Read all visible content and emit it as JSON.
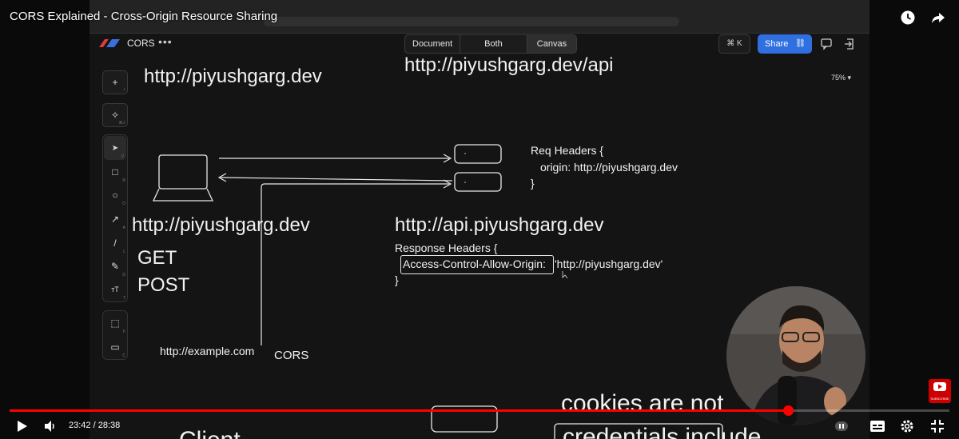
{
  "youtube": {
    "video_title": "CORS Explained - Cross-Origin Resource Sharing",
    "time_current": "23:42",
    "time_separator": " / ",
    "time_total": "28:38",
    "progress_fraction": 0.828,
    "subscribe_label": "SUBSCRIBE",
    "icons": [
      "watch-later-icon",
      "share-icon",
      "play-icon",
      "volume-icon",
      "pause-icon",
      "subtitles-icon",
      "settings-icon",
      "fullscreen-exit-icon"
    ]
  },
  "app": {
    "name": "CORS",
    "menu_label": "•••",
    "view_modes": [
      "Document",
      "Both",
      "Canvas"
    ],
    "active_view": "Canvas",
    "command_shortcut": "⌘ K",
    "share_label": "Share",
    "zoom": "75%"
  },
  "toolbar": {
    "tools": [
      {
        "name": "add",
        "glyph": "+",
        "key": "/"
      },
      {
        "name": "magic",
        "glyph": "✧",
        "key": "⌘J"
      },
      {
        "name": "select",
        "glyph": "➤",
        "key": "V"
      },
      {
        "name": "rectangle",
        "glyph": "□",
        "key": "R"
      },
      {
        "name": "ellipse",
        "glyph": "○",
        "key": "O"
      },
      {
        "name": "arrow",
        "glyph": "↗",
        "key": "A"
      },
      {
        "name": "line",
        "glyph": "/",
        "key": "L"
      },
      {
        "name": "pencil",
        "glyph": "✎",
        "key": "D"
      },
      {
        "name": "text",
        "glyph": "ᴛT",
        "key": "T"
      },
      {
        "name": "frame",
        "glyph": "⬚",
        "key": "F"
      },
      {
        "name": "comment",
        "glyph": "▭",
        "key": "C"
      }
    ]
  },
  "canvas": {
    "origin_top": "http://piyushgarg.dev",
    "api_top": "http://piyushgarg.dev/api",
    "client_origin": "http://piyushgarg.dev",
    "method_get": "GET",
    "method_post": "POST",
    "example_origin": "http://example.com",
    "cors_label": "CORS",
    "api_origin": "http://api.piyushgarg.dev",
    "req_headers_open": "Req Headers {",
    "req_origin_line": "origin: http://piyushgarg.dev",
    "req_headers_close": "}",
    "res_headers_open": "Response Headers {",
    "acao_key": "Access-Control-Allow-Origin:",
    "acao_value": "'http://piyushgarg.dev'",
    "res_headers_close": "}",
    "bottom_text_1": "cookies are not",
    "bottom_text_2": "credentials include",
    "bottom_text_3": "Client"
  }
}
